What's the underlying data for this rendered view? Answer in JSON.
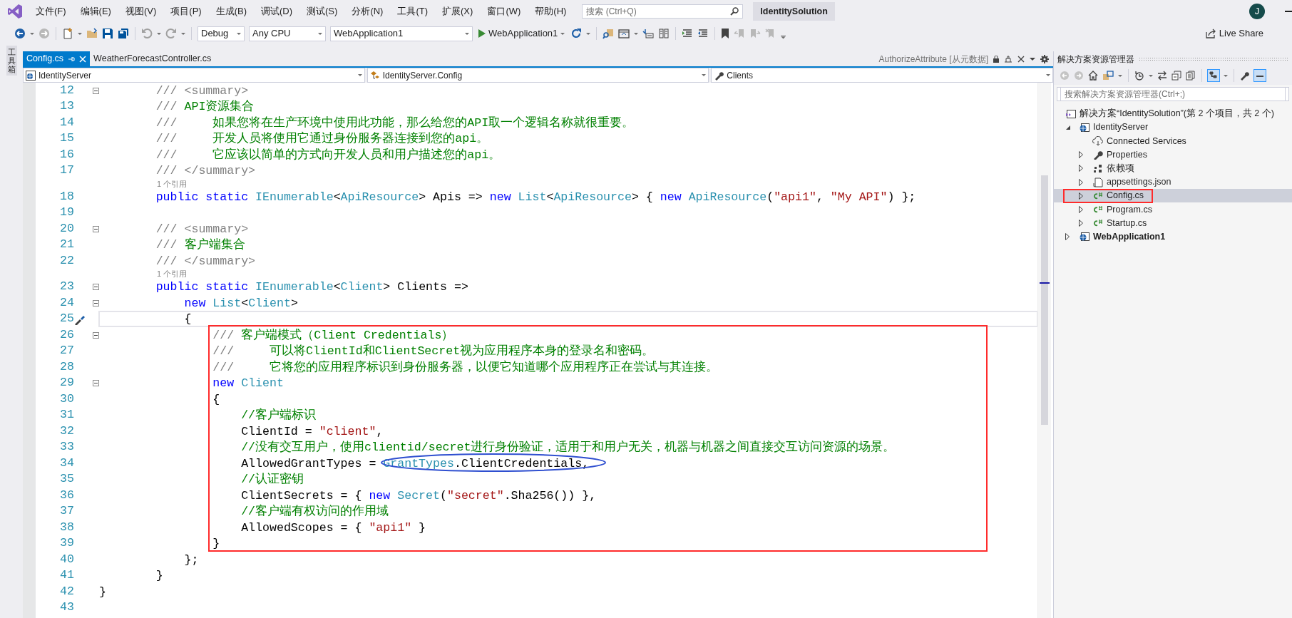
{
  "menu": [
    {
      "label": "文件(F)"
    },
    {
      "label": "编辑(E)"
    },
    {
      "label": "视图(V)"
    },
    {
      "label": "项目(P)"
    },
    {
      "label": "生成(B)"
    },
    {
      "label": "调试(D)"
    },
    {
      "label": "测试(S)"
    },
    {
      "label": "分析(N)"
    },
    {
      "label": "工具(T)"
    },
    {
      "label": "扩展(X)"
    },
    {
      "label": "窗口(W)"
    },
    {
      "label": "帮助(H)"
    }
  ],
  "search": {
    "placeholder": "搜索 (Ctrl+Q)"
  },
  "solution_title": "IdentitySolution",
  "account_initial": "J",
  "toolbar": {
    "configuration": "Debug",
    "platform": "Any CPU",
    "startup_project": "WebApplication1",
    "run_label": "WebApplication1",
    "live_share": "Live Share"
  },
  "toolbox_label": "工具箱",
  "tabs": [
    {
      "label": "Config.cs",
      "selected": true
    },
    {
      "label": "WeatherForecastController.cs",
      "selected": false
    }
  ],
  "preview_tab": "AuthorizeAttribute [从元数据]",
  "nav_bar": [
    {
      "kind": "project",
      "label": "IdentityServer"
    },
    {
      "kind": "class",
      "label": "IdentityServer.Config"
    },
    {
      "kind": "member",
      "label": "Clients"
    }
  ],
  "code_lines": [
    {
      "kind": "line",
      "number": "12",
      "foldable": true,
      "current": false,
      "quick_actions": false,
      "segments": [
        {
          "kind": "doc",
          "text": "        /// <summary>"
        }
      ]
    },
    {
      "kind": "line",
      "number": "13",
      "foldable": false,
      "current": false,
      "quick_actions": false,
      "segments": [
        {
          "kind": "doc",
          "text": "        /// "
        },
        {
          "kind": "comment",
          "text": "API资源集合"
        }
      ]
    },
    {
      "kind": "line",
      "number": "14",
      "foldable": false,
      "current": false,
      "quick_actions": false,
      "segments": [
        {
          "kind": "doc",
          "text": "        ///     "
        },
        {
          "kind": "comment",
          "text": "如果您将在生产环境中使用此功能，那么给您的API取一个逻辑名称就很重要。"
        }
      ]
    },
    {
      "kind": "line",
      "number": "15",
      "foldable": false,
      "current": false,
      "quick_actions": false,
      "segments": [
        {
          "kind": "doc",
          "text": "        ///     "
        },
        {
          "kind": "comment",
          "text": "开发人员将使用它通过身份服务器连接到您的api。"
        }
      ]
    },
    {
      "kind": "line",
      "number": "16",
      "foldable": false,
      "current": false,
      "quick_actions": false,
      "segments": [
        {
          "kind": "doc",
          "text": "        ///     "
        },
        {
          "kind": "comment",
          "text": "它应该以简单的方式向开发人员和用户描述您的api。"
        }
      ]
    },
    {
      "kind": "line",
      "number": "17",
      "foldable": false,
      "current": false,
      "quick_actions": false,
      "segments": [
        {
          "kind": "doc",
          "text": "        /// </summary>"
        }
      ]
    },
    {
      "kind": "codelens",
      "text": "1 个引用"
    },
    {
      "kind": "line",
      "number": "18",
      "foldable": false,
      "current": false,
      "quick_actions": false,
      "segments": [
        {
          "kind": "keyword",
          "text": "        public static "
        },
        {
          "kind": "type",
          "text": "IEnumerable"
        },
        {
          "kind": "plain",
          "text": "<"
        },
        {
          "kind": "type",
          "text": "ApiResource"
        },
        {
          "kind": "plain",
          "text": "> Apis => "
        },
        {
          "kind": "keyword",
          "text": "new "
        },
        {
          "kind": "type",
          "text": "List"
        },
        {
          "kind": "plain",
          "text": "<"
        },
        {
          "kind": "type",
          "text": "ApiResource"
        },
        {
          "kind": "plain",
          "text": "> { "
        },
        {
          "kind": "keyword",
          "text": "new "
        },
        {
          "kind": "type",
          "text": "ApiResource"
        },
        {
          "kind": "plain",
          "text": "("
        },
        {
          "kind": "string",
          "text": "\"api1\""
        },
        {
          "kind": "plain",
          "text": ", "
        },
        {
          "kind": "string",
          "text": "\"My API\""
        },
        {
          "kind": "plain",
          "text": ") };"
        }
      ]
    },
    {
      "kind": "line",
      "number": "19",
      "foldable": false,
      "current": false,
      "quick_actions": false
    },
    {
      "kind": "line",
      "number": "20",
      "foldable": true,
      "current": false,
      "quick_actions": false,
      "segments": [
        {
          "kind": "doc",
          "text": "        /// <summary>"
        }
      ]
    },
    {
      "kind": "line",
      "number": "21",
      "foldable": false,
      "current": false,
      "quick_actions": false,
      "segments": [
        {
          "kind": "doc",
          "text": "        /// "
        },
        {
          "kind": "comment",
          "text": "客户端集合"
        }
      ]
    },
    {
      "kind": "line",
      "number": "22",
      "foldable": false,
      "current": false,
      "quick_actions": false,
      "segments": [
        {
          "kind": "doc",
          "text": "        /// </summary>"
        }
      ]
    },
    {
      "kind": "codelens",
      "text": "1 个引用"
    },
    {
      "kind": "line",
      "number": "23",
      "foldable": true,
      "current": false,
      "quick_actions": false,
      "segments": [
        {
          "kind": "keyword",
          "text": "        public static "
        },
        {
          "kind": "type",
          "text": "IEnumerable"
        },
        {
          "kind": "plain",
          "text": "<"
        },
        {
          "kind": "type",
          "text": "Client"
        },
        {
          "kind": "plain",
          "text": "> Clients =>"
        }
      ]
    },
    {
      "kind": "line",
      "number": "24",
      "foldable": true,
      "current": false,
      "quick_actions": false,
      "segments": [
        {
          "kind": "keyword",
          "text": "            new "
        },
        {
          "kind": "type",
          "text": "List"
        },
        {
          "kind": "plain",
          "text": "<"
        },
        {
          "kind": "type",
          "text": "Client"
        },
        {
          "kind": "plain",
          "text": ">"
        }
      ]
    },
    {
      "kind": "line",
      "number": "25",
      "foldable": false,
      "current": true,
      "quick_actions": true,
      "segments": [
        {
          "kind": "plain",
          "text": "            {"
        }
      ]
    },
    {
      "kind": "line",
      "number": "26",
      "foldable": true,
      "current": false,
      "quick_actions": false,
      "segments": [
        {
          "kind": "doc",
          "text": "                /// "
        },
        {
          "kind": "comment",
          "text": "客户端模式（Client Credentials）"
        }
      ]
    },
    {
      "kind": "line",
      "number": "27",
      "foldable": false,
      "current": false,
      "quick_actions": false,
      "segments": [
        {
          "kind": "doc",
          "text": "                ///     "
        },
        {
          "kind": "comment",
          "text": "可以将ClientId和ClientSecret视为应用程序本身的登录名和密码。"
        }
      ]
    },
    {
      "kind": "line",
      "number": "28",
      "foldable": false,
      "current": false,
      "quick_actions": false,
      "segments": [
        {
          "kind": "doc",
          "text": "                ///     "
        },
        {
          "kind": "comment",
          "text": "它将您的应用程序标识到身份服务器，以便它知道哪个应用程序正在尝试与其连接。"
        }
      ]
    },
    {
      "kind": "line",
      "number": "29",
      "foldable": true,
      "current": false,
      "quick_actions": false,
      "segments": [
        {
          "kind": "keyword",
          "text": "                new "
        },
        {
          "kind": "type",
          "text": "Client"
        }
      ]
    },
    {
      "kind": "line",
      "number": "30",
      "foldable": false,
      "current": false,
      "quick_actions": false,
      "segments": [
        {
          "kind": "plain",
          "text": "                {"
        }
      ]
    },
    {
      "kind": "line",
      "number": "31",
      "foldable": false,
      "current": false,
      "quick_actions": false,
      "segments": [
        {
          "kind": "comment",
          "text": "                    //客户端标识"
        }
      ]
    },
    {
      "kind": "line",
      "number": "32",
      "foldable": false,
      "current": false,
      "quick_actions": false,
      "segments": [
        {
          "kind": "plain",
          "text": "                    ClientId = "
        },
        {
          "kind": "string",
          "text": "\"client\""
        },
        {
          "kind": "plain",
          "text": ","
        }
      ]
    },
    {
      "kind": "line",
      "number": "33",
      "foldable": false,
      "current": false,
      "quick_actions": false,
      "segments": [
        {
          "kind": "comment",
          "text": "                    //没有交互用户，使用clientid/secret进行身份验证，适用于和用户无关，机器与机器之间直接交互访问资源的场景。"
        }
      ]
    },
    {
      "kind": "line",
      "number": "34",
      "foldable": false,
      "current": false,
      "quick_actions": false,
      "segments": [
        {
          "kind": "plain",
          "text": "                    AllowedGrantTypes = "
        },
        {
          "kind": "type",
          "text": "GrantTypes"
        },
        {
          "kind": "plain",
          "text": ".ClientCredentials,"
        }
      ]
    },
    {
      "kind": "line",
      "number": "35",
      "foldable": false,
      "current": false,
      "quick_actions": false,
      "segments": [
        {
          "kind": "comment",
          "text": "                    //认证密钥"
        }
      ]
    },
    {
      "kind": "line",
      "number": "36",
      "foldable": false,
      "current": false,
      "quick_actions": false,
      "segments": [
        {
          "kind": "plain",
          "text": "                    ClientSecrets = { "
        },
        {
          "kind": "keyword",
          "text": "new "
        },
        {
          "kind": "type",
          "text": "Secret"
        },
        {
          "kind": "plain",
          "text": "("
        },
        {
          "kind": "string",
          "text": "\"secret\""
        },
        {
          "kind": "plain",
          "text": ".Sha256()) },"
        }
      ]
    },
    {
      "kind": "line",
      "number": "37",
      "foldable": false,
      "current": false,
      "quick_actions": false,
      "segments": [
        {
          "kind": "comment",
          "text": "                    //客户端有权访问的作用域"
        }
      ]
    },
    {
      "kind": "line",
      "number": "38",
      "foldable": false,
      "current": false,
      "quick_actions": false,
      "segments": [
        {
          "kind": "plain",
          "text": "                    AllowedScopes = { "
        },
        {
          "kind": "string",
          "text": "\"api1\""
        },
        {
          "kind": "plain",
          "text": " }"
        }
      ]
    },
    {
      "kind": "line",
      "number": "39",
      "foldable": false,
      "current": false,
      "quick_actions": false,
      "segments": [
        {
          "kind": "plain",
          "text": "                }"
        }
      ]
    },
    {
      "kind": "line",
      "number": "40",
      "foldable": false,
      "current": false,
      "quick_actions": false,
      "segments": [
        {
          "kind": "plain",
          "text": "            };"
        }
      ]
    },
    {
      "kind": "line",
      "number": "41",
      "foldable": false,
      "current": false,
      "quick_actions": false,
      "segments": [
        {
          "kind": "plain",
          "text": "        }"
        }
      ]
    },
    {
      "kind": "line",
      "number": "42",
      "foldable": false,
      "current": false,
      "quick_actions": false,
      "segments": [
        {
          "kind": "plain",
          "text": "}"
        }
      ]
    },
    {
      "kind": "line",
      "number": "43",
      "foldable": false,
      "current": false,
      "quick_actions": false
    }
  ],
  "solution_explorer": {
    "title": "解决方案资源管理器",
    "search": {
      "placeholder": "搜索解决方案资源管理器(Ctrl+;)"
    },
    "tree": [
      {
        "kind": "solution",
        "label": "解决方案“IdentitySolution”(第 2 个项目，共 2 个)",
        "selected": false,
        "children": [
          {
            "kind": "project",
            "label": "IdentityServer",
            "startup": false,
            "expanded": true,
            "selected": false,
            "children": [
              {
                "kind": "connected",
                "label": "Connected Services",
                "selected": false
              },
              {
                "kind": "folder",
                "label": "Properties",
                "expanded": false,
                "selected": false
              },
              {
                "kind": "dependencies",
                "label": "依赖项",
                "expanded": false,
                "selected": false
              },
              {
                "kind": "json",
                "label": "appsettings.json",
                "expanded": false,
                "selected": false
              },
              {
                "kind": "csharp",
                "label": "Config.cs",
                "expanded": false,
                "selected": true
              },
              {
                "kind": "csharp",
                "label": "Program.cs",
                "expanded": false,
                "selected": false
              },
              {
                "kind": "csharp",
                "label": "Startup.cs",
                "expanded": false,
                "selected": false
              }
            ]
          },
          {
            "kind": "project",
            "label": "WebApplication1",
            "startup": true,
            "expanded": false,
            "selected": false
          }
        ]
      }
    ]
  },
  "annotations": [
    {
      "kind": "box",
      "color": "#ff2b2b"
    },
    {
      "kind": "ellipse",
      "color": "#2f4fd0"
    },
    {
      "kind": "box",
      "color": "#ff2b2b"
    }
  ]
}
